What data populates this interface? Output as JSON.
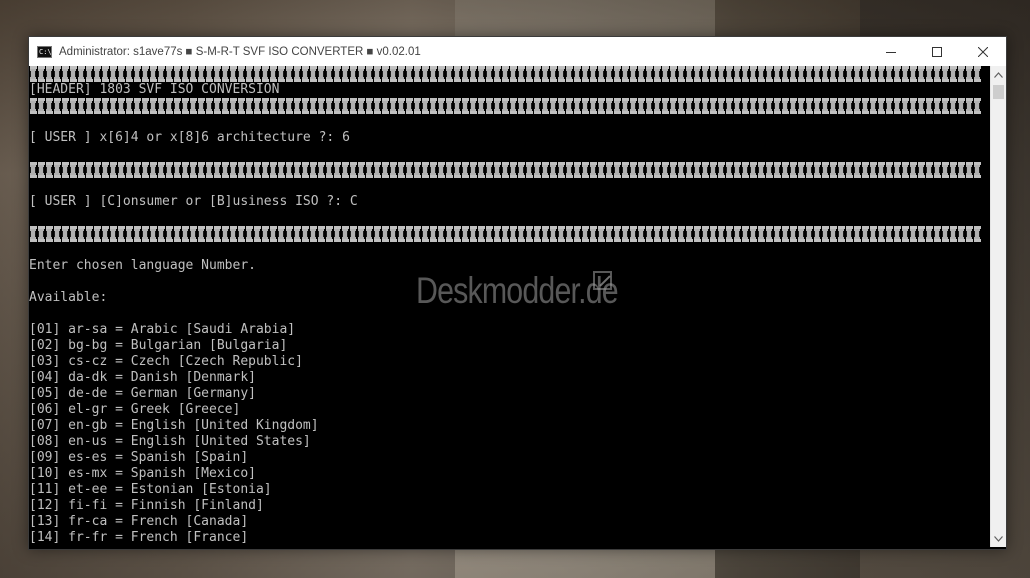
{
  "window": {
    "title": "Administrator:  s1ave77s ■ S-M-R-T SVF ISO CONVERTER ■ v0.02.01",
    "icon_text": "C:\\.",
    "controls": {
      "minimize": "minimize",
      "maximize": "maximize",
      "close": "close"
    }
  },
  "console": {
    "header": "[HEADER] 1803 SVF ISO CONVERSION",
    "prompt_arch": "[ USER ] x[6]4 or x[8]6 architecture ?: 6",
    "prompt_type": "[ USER ] [C]onsumer or [B]usiness ISO ?: C",
    "language_prompt": "Enter chosen language Number.",
    "available_label": "Available:",
    "languages": [
      "[01] ar-sa = Arabic [Saudi Arabia]",
      "[02] bg-bg = Bulgarian [Bulgaria]",
      "[03] cs-cz = Czech [Czech Republic]",
      "[04] da-dk = Danish [Denmark]",
      "[05] de-de = German [Germany]",
      "[06] el-gr = Greek [Greece]",
      "[07] en-gb = English [United Kingdom]",
      "[08] en-us = English [United States]",
      "[09] es-es = Spanish [Spain]",
      "[10] es-mx = Spanish [Mexico]",
      "[11] et-ee = Estonian [Estonia]",
      "[12] fi-fi = Finnish [Finland]",
      "[13] fr-ca = French [Canada]",
      "[14] fr-fr = French [France]"
    ]
  },
  "watermark": "Deskmodder.de",
  "icons": {
    "app": "console-icon",
    "watermark_pen": "edit-icon"
  },
  "colors": {
    "console_bg": "#000000",
    "console_fg": "#c0c0c0",
    "titlebar_bg": "#ffffff"
  }
}
